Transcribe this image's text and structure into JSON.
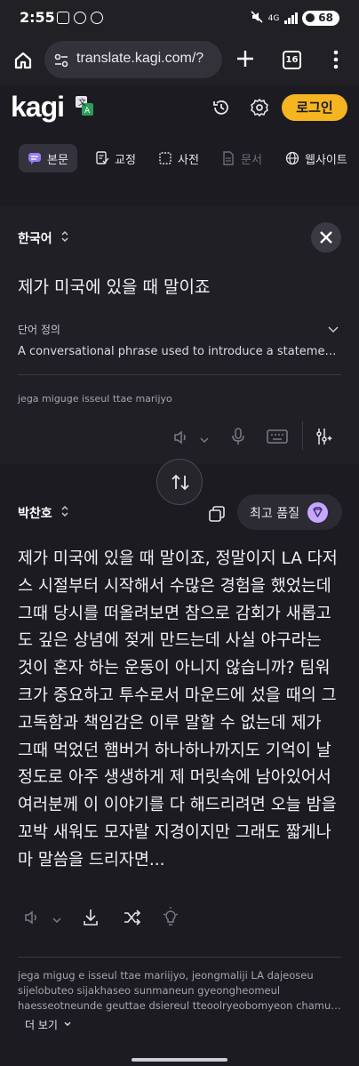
{
  "status_bar": {
    "time": "2:55",
    "network": "4G",
    "battery": "68"
  },
  "browser": {
    "url": "translate.kagi.com/?",
    "tab_count": "16"
  },
  "header": {
    "logo": "kagi",
    "login_label": "로그인"
  },
  "tabs": [
    {
      "label": "본문",
      "icon": "chat-icon"
    },
    {
      "label": "교정",
      "icon": "proofread-icon"
    },
    {
      "label": "사전",
      "icon": "book-icon"
    },
    {
      "label": "문서",
      "icon": "document-icon"
    },
    {
      "label": "웹사이트",
      "icon": "globe-icon"
    }
  ],
  "source": {
    "language": "한국어",
    "text": "제가 미국에 있을 때 말이죠",
    "definition_label": "단어 정의",
    "definition_text": "A conversational phrase used to introduce a statement about one's time in America",
    "romanization": "jega miguge isseul ttae marijyo"
  },
  "target": {
    "language": "박찬호",
    "quality_label": "최고 품질",
    "text": "제가 미국에 있을 때 말이죠, 정말이지 LA 다저스 시절부터 시작해서 수많은 경험을 했었는데 그때 당시를 떠올려보면 참으로 감회가 새롭고도 깊은 상념에 젖게 만드는데 사실 야구라는 것이 혼자 하는 운동이 아니지 않습니까? 팀워크가 중요하고 투수로서 마운드에 섰을 때의 그 고독함과 책임감은 이루 말할 수 없는데 제가 그때 먹었던 햄버거 하나하나까지도 기억이 날 정도로 아주 생생하게 제 머릿속에 남아있어서 여러분께 이 이야기를 다 해드리려면 오늘 밤을 꼬박 새워도 모자랄 지경이지만 그래도 짧게나마 말씀을 드리자면...",
    "romanization_lines": [
      "jega migug e isseul ttae mariijyo, jeongmaliji LA dajeoseu",
      "sijelobuteo sijakhaseo sunmaneun gyeongheomeul",
      "haesseotneunde geuttae dsiereul tteoolryeobomyeon chamuro gamhoega saerobgodo"
    ],
    "more_label": "더 보기"
  },
  "colors": {
    "accent": "#f4b521",
    "gem": "#c6a6ff",
    "background": "#1c1b21"
  }
}
